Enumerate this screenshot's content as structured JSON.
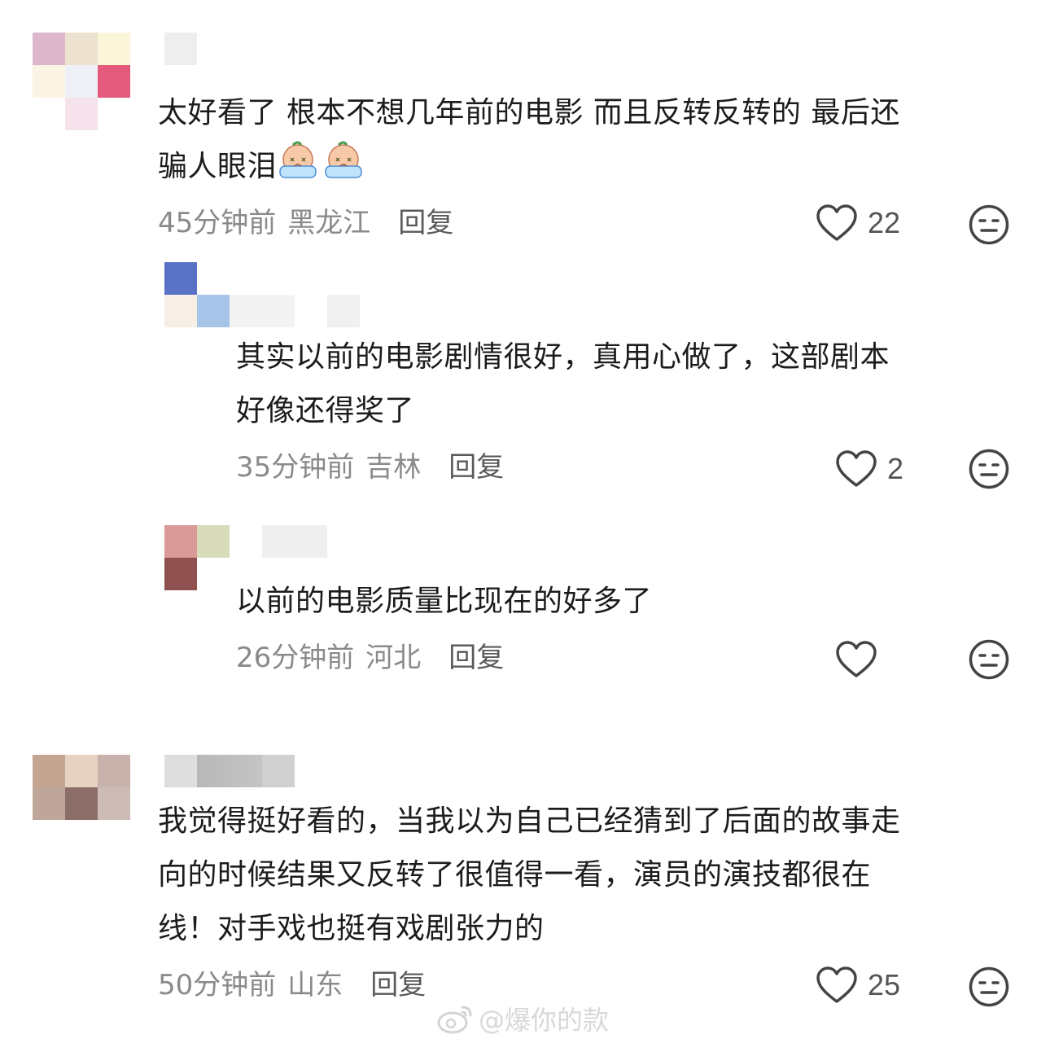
{
  "comments": [
    {
      "text_lines": [
        "太好看了 根本不想几年前的电影 而且反转反转的 最后还",
        "骗人眼泪"
      ],
      "time": "45分钟前",
      "location": "黑龙江",
      "reply_label": "回复",
      "likes": "22",
      "replies": [
        {
          "text_lines": [
            "其实以前的电影剧情很好，真用心做了，这部剧本",
            "好像还得奖了"
          ],
          "time": "35分钟前",
          "location": "吉林",
          "reply_label": "回复",
          "likes": "2"
        },
        {
          "text_lines": [
            "以前的电影质量比现在的好多了"
          ],
          "time": "26分钟前",
          "location": "河北",
          "reply_label": "回复",
          "likes": ""
        }
      ]
    },
    {
      "text_lines": [
        "我觉得挺好看的，当我以为自己已经猜到了后面的故事走",
        "向的时候结果又反转了很值得一看，演员的演技都很在",
        "线！对手戏也挺有戏剧张力的"
      ],
      "time": "50分钟前",
      "location": "山东",
      "reply_label": "回复",
      "likes": "25"
    }
  ],
  "watermark": "@爆你的款",
  "icons": {
    "like": "heart-outline-icon",
    "dislike": "meh-face-icon",
    "emoji": "crying-face-emoji",
    "watermark": "weibo-logo-icon"
  },
  "colors": {
    "text": "#1c1c1c",
    "meta": "#8a8a8a",
    "reply": "#5a5a5a",
    "icon": "#444444"
  }
}
